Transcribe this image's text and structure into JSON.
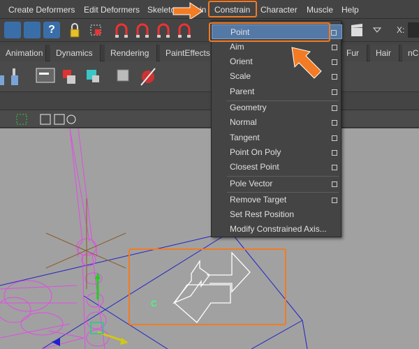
{
  "menubar": {
    "items": [
      "Create Deformers",
      "Edit Deformers",
      "Skeleton",
      "Skin",
      "Constrain",
      "Character",
      "Muscle",
      "Help"
    ]
  },
  "toolbar": {
    "x_label": "X:"
  },
  "shelf_tabs": [
    "Animation",
    "Dynamics",
    "Rendering",
    "PaintEffects",
    "Fur",
    "Hair",
    "nC"
  ],
  "constrain_menu": {
    "items": [
      "Point",
      "Aim",
      "Orient",
      "Scale",
      "Parent",
      "Geometry",
      "Normal",
      "Tangent",
      "Point On Poly",
      "Closest Point",
      "Pole Vector",
      "Remove Target",
      "Set Rest Position",
      "Modify Constrained Axis..."
    ],
    "highlighted": "Point"
  },
  "viewport": {
    "manipulator_label": "C"
  },
  "colors": {
    "highlight_orange": "#f27b23",
    "menu_highlight": "#5579a6",
    "wireframe_magenta": "#e24be6",
    "viewport_bg": "#a1a1a1"
  },
  "icons": [
    "lock-icon",
    "magnet-icon",
    "question-icon",
    "clapper-icon",
    "chevron-down-icon",
    "point-arrow-icon"
  ]
}
